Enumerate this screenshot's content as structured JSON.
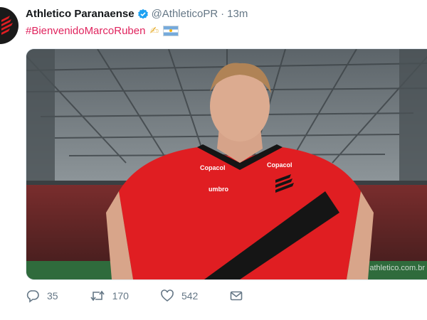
{
  "tweet": {
    "author_name": "Athletico Paranaense",
    "handle": "@AthleticoPR",
    "separator": "·",
    "time": "13m",
    "hashtag": "#BienvenidoMarcoRuben",
    "emoji_names": [
      "writing-hand-icon",
      "argentina-flag-icon"
    ]
  },
  "media": {
    "jersey_sponsor": "Copacol",
    "jersey_brand": "umbro",
    "watermark": "athletico.com.br",
    "colors": {
      "jersey_red": "#e01e22",
      "jersey_black": "#151515"
    }
  },
  "actions": {
    "reply_count": "35",
    "retweet_count": "170",
    "like_count": "542",
    "icons": [
      "reply-icon",
      "retweet-icon",
      "like-icon",
      "direct-message-icon"
    ]
  },
  "colors": {
    "hashtag": "#e0245e",
    "secondary_text": "#657786",
    "verified_badge": "#1da1f2"
  }
}
